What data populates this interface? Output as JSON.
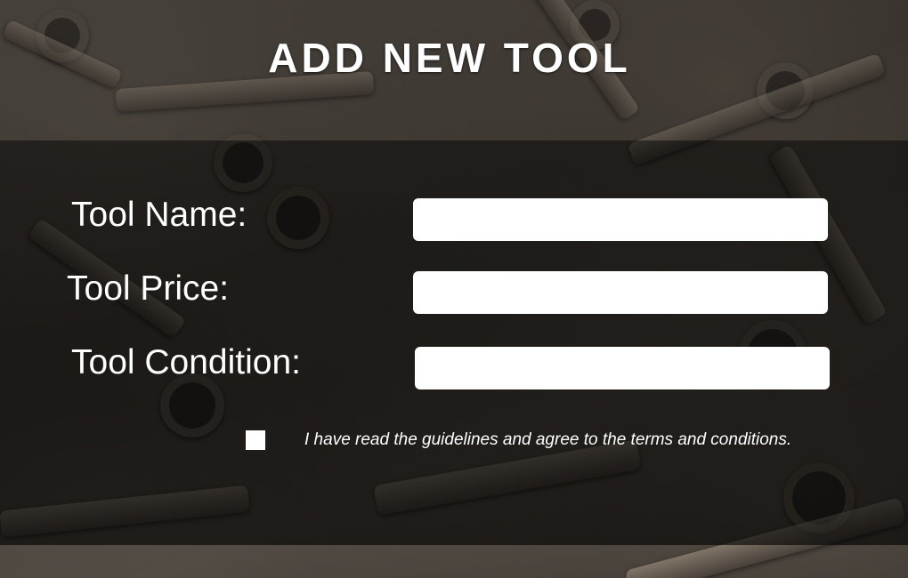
{
  "header": {
    "title": "ADD NEW TOOL"
  },
  "form": {
    "fields": [
      {
        "label": "Tool Name:",
        "value": "",
        "placeholder": ""
      },
      {
        "label": "Tool Price:",
        "value": "",
        "placeholder": ""
      },
      {
        "label": "Tool Condition:",
        "value": "",
        "placeholder": ""
      }
    ],
    "agreement": {
      "checked": false,
      "text": "I have read the guidelines and agree to the terms and conditions."
    }
  },
  "colors": {
    "text": "#ffffff",
    "field_background": "#ffffff",
    "panel_overlay": "#000000"
  }
}
